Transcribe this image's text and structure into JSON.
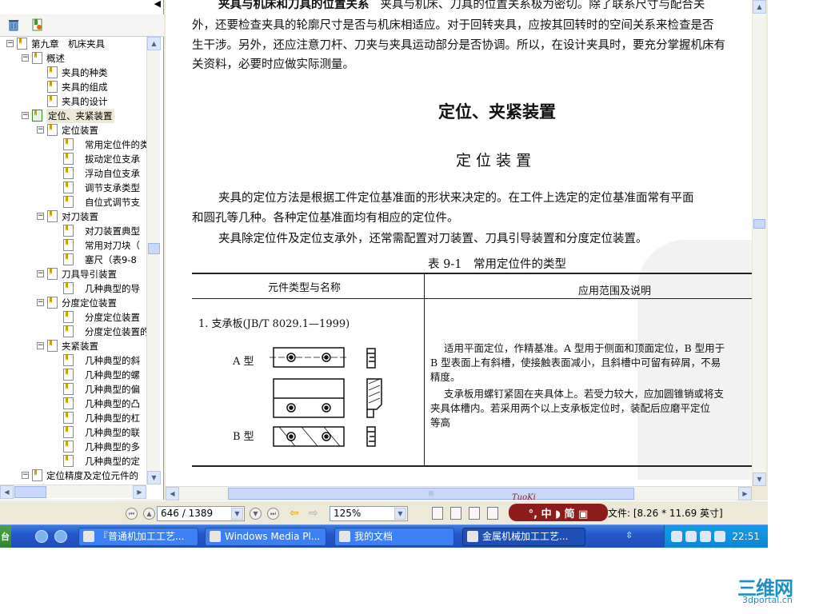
{
  "tree": {
    "collapse_button": "◀",
    "items": [
      {
        "label": "第九章　机床夹具",
        "level": 0,
        "expander": "−"
      },
      {
        "label": "概述",
        "level": 1,
        "expander": "−"
      },
      {
        "label": "夹具的种类",
        "level": 2
      },
      {
        "label": "夹具的组成",
        "level": 2
      },
      {
        "label": "夹具的设计",
        "level": 2
      },
      {
        "label": "定位、夹紧装置",
        "level": 1,
        "expander": "−",
        "selected": true
      },
      {
        "label": "定位装置",
        "level": 2,
        "expander": "−"
      },
      {
        "label": "常用定位件的类",
        "level": 3
      },
      {
        "label": "拔动定位支承",
        "level": 3
      },
      {
        "label": "浮动自位支承",
        "level": 3
      },
      {
        "label": "调节支承类型",
        "level": 3
      },
      {
        "label": "自位式调节支",
        "level": 3
      },
      {
        "label": "对刀装置",
        "level": 2,
        "expander": "−"
      },
      {
        "label": "对刀装置典型",
        "level": 3
      },
      {
        "label": "常用对刀块（",
        "level": 3
      },
      {
        "label": "塞尺（表9-8",
        "level": 3
      },
      {
        "label": "刀具导引装置",
        "level": 2,
        "expander": "−"
      },
      {
        "label": "几种典型的导",
        "level": 3
      },
      {
        "label": "分度定位装置",
        "level": 2,
        "expander": "−"
      },
      {
        "label": "分度定位装置",
        "level": 3
      },
      {
        "label": "分度定位装置的",
        "level": 3
      },
      {
        "label": "夹紧装置",
        "level": 2,
        "expander": "−"
      },
      {
        "label": "几种典型的斜",
        "level": 3
      },
      {
        "label": "几种典型的螺",
        "level": 3
      },
      {
        "label": "几种典型的偏",
        "level": 3
      },
      {
        "label": "几种典型的凸",
        "level": 3
      },
      {
        "label": "几种典型的杠",
        "level": 3
      },
      {
        "label": "几种典型的联",
        "level": 3
      },
      {
        "label": "几种典型的多",
        "level": 3
      },
      {
        "label": "几种典型的定",
        "level": 3
      },
      {
        "label": "定位精度及定位元件的",
        "level": 1,
        "expander": "−"
      }
    ]
  },
  "page": {
    "para1_lead": "夹具与机床和刀具的位置关系",
    "para1_line1": "夹具与机床、刀具的位置关系极为密切。除了联系尺寸与配合关",
    "para1_line2": "外，还要检查夹具的轮廓尺寸是否与机床相适应。对于回转夹具，应按其回转时的空间关系来检查是否",
    "para1_line3": "生干涉。另外，还应注意刀杆、刀夹与夹具运动部分是否协调。所以，在设计夹具时，要充分掌握机床有",
    "para1_line4": "关资料，必要时应做实际测量。",
    "section_title": "定位、夹紧装置",
    "subsection_title": "定 位 装 置",
    "para2_line1": "夹具的定位方法是根据工件定位基准面的形状来决定的。在工件上选定的定位基准面常有平面",
    "para2_line2": "和圆孔等几种。各种定位基准面均有相应的定位件。",
    "para3": "夹具除定位件及定位支承外，还常需配置对刀装置、刀具引导装置和分度定位装置。",
    "table_caption": "表 9-1　常用定位件的类型",
    "col1_header": "元件类型与名称",
    "col2_header": "应用范围及说明",
    "row1_name": "1. 支承板(JB/T 8029.1—1999)",
    "type_a": "A 型",
    "type_b": "B 型",
    "desc_line1": "适用平面定位，作精基准。A 型用于侧面和顶面定位，B 型用于",
    "desc_line2": "B 型表面上有斜槽，使接触表面减小，且斜槽中可留有碎屑，不易",
    "desc_line3": "精度。",
    "desc_line4": "支承板用螺钉紧固在夹具体上。若受力较大，应加圆锥销或将支",
    "desc_line5": "夹具体槽内。若采用两个以上支承板定位时，装配后应磨平定位",
    "desc_line6": "等高"
  },
  "status": {
    "page_indicator": "646 / 1389",
    "zoom": "125%",
    "file_info": "文件: [8.26 * 11.69 英寸]",
    "ime_label": "°, 中 ◗ 简 ▣",
    "ime_brand": "TuoKi"
  },
  "taskbar": {
    "start_label": "台",
    "tasks": [
      {
        "label": "『普通机加工工艺...",
        "active": false
      },
      {
        "label": "Windows Media Pl...",
        "active": false
      },
      {
        "label": "我的文档",
        "active": false
      },
      {
        "label": "金属机械加工工艺...",
        "active": true
      }
    ],
    "clock": "22:51"
  },
  "watermark": {
    "main": "三维网",
    "sub": "3dportal.cn"
  },
  "colors": {
    "taskbar": "#2457c8",
    "tray": "#0c86d6",
    "ime": "#8e1c1c",
    "watermark": "#1e8fc4",
    "chrome": "#ece9d8"
  }
}
